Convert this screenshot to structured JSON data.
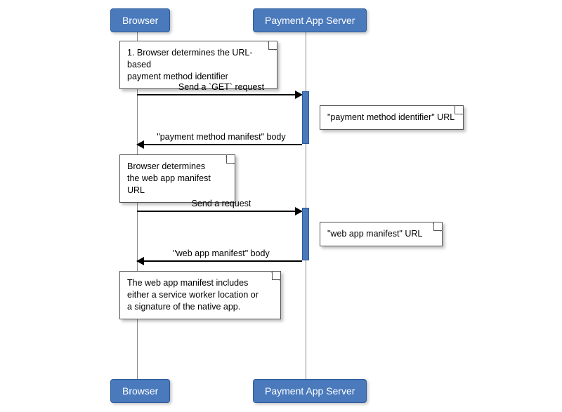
{
  "participants": {
    "left": "Browser",
    "right": "Payment App Server"
  },
  "notes": {
    "n1": "1. Browser determines the URL-based\npayment method identifier",
    "n2": "\"payment method identifier\" URL",
    "n3": "Browser determines\nthe web app manifest URL",
    "n4": "\"web app manifest\" URL",
    "n5": "The web app manifest includes\neither a service worker location or\na signature of the native app."
  },
  "messages": {
    "m1": "Send a `GET` request",
    "m2": "\"payment method manifest\" body",
    "m3": "Send a request",
    "m4": "\"web app manifest\" body"
  }
}
